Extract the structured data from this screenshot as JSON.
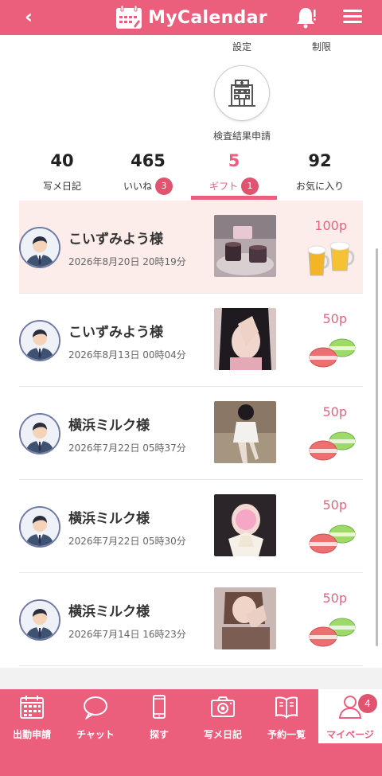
{
  "header": {
    "back_icon": "chevron-left-icon",
    "title": "MyCalendar",
    "calendar_icon": "calendar-icon",
    "bell_icon": "bell-alert-icon",
    "menu_icon": "hamburger-menu-icon"
  },
  "top_menu": {
    "settings_label": "設定",
    "limit_label": "制限",
    "exam_label": "検査結果申請",
    "exam_icon": "hospital-icon"
  },
  "stats": [
    {
      "value": "40",
      "label": "写メ日記",
      "badge": ""
    },
    {
      "value": "465",
      "label": "いいね",
      "badge": "3"
    },
    {
      "value": "5",
      "label": "ギフト",
      "badge": "1"
    },
    {
      "value": "92",
      "label": "お気に入り",
      "badge": ""
    }
  ],
  "active_stat": "ギフト",
  "gifts": [
    {
      "name": "こいずみよう様",
      "date": "2026年8月20日 20時19分",
      "points": "100p",
      "gift_icon": "beer-mugs-icon",
      "highlighted": true
    },
    {
      "name": "こいずみよう様",
      "date": "2026年8月13日 00時04分",
      "points": "50p",
      "gift_icon": "macarons-icon",
      "highlighted": false
    },
    {
      "name": "横浜ミルク様",
      "date": "2026年7月22日 05時37分",
      "points": "50p",
      "gift_icon": "macarons-icon",
      "highlighted": false
    },
    {
      "name": "横浜ミルク様",
      "date": "2026年7月22日 05時30分",
      "points": "50p",
      "gift_icon": "macarons-icon",
      "highlighted": false
    },
    {
      "name": "横浜ミルク様",
      "date": "2026年7月14日 16時23分",
      "points": "50p",
      "gift_icon": "macarons-icon",
      "highlighted": false
    }
  ],
  "bottom_nav": [
    {
      "label": "出勤申請",
      "icon": "calendar-icon"
    },
    {
      "label": "チャット",
      "icon": "chat-bubble-icon"
    },
    {
      "label": "探す",
      "icon": "smartphone-icon"
    },
    {
      "label": "写メ日記",
      "icon": "camera-icon"
    },
    {
      "label": "予約一覧",
      "icon": "book-icon"
    },
    {
      "label": "マイページ",
      "icon": "user-icon",
      "badge": "4",
      "active": true
    }
  ],
  "colors": {
    "brand": "#ec5f7c",
    "badge": "#e1546f",
    "highlight_row": "#fcecea"
  }
}
